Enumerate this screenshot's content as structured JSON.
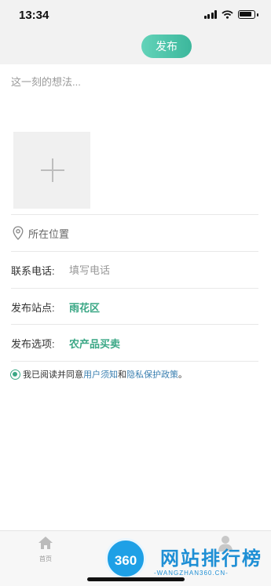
{
  "status": {
    "time": "13:34"
  },
  "header": {
    "publish_label": "发布"
  },
  "post": {
    "placeholder": "这一刻的想法..."
  },
  "location": {
    "label": "所在位置"
  },
  "phone": {
    "label": "联系电话:",
    "placeholder": "填写电话"
  },
  "station": {
    "label": "发布站点:",
    "value": "雨花区"
  },
  "option": {
    "label": "发布选项:",
    "value": "农产品买卖"
  },
  "agreement": {
    "prefix": "我已阅读并同意",
    "link1": "用户须知",
    "middle": "和",
    "link2": "隐私保护政策",
    "suffix": "。"
  },
  "tabbar": {
    "home_label": "首页"
  },
  "watermark": {
    "badge": "360",
    "title": "网站排行榜",
    "url": "-WANGZHAN360.CN-"
  },
  "colors": {
    "accent": "#3aa785",
    "button": "#3cb79c",
    "link": "#3a7fb0"
  }
}
